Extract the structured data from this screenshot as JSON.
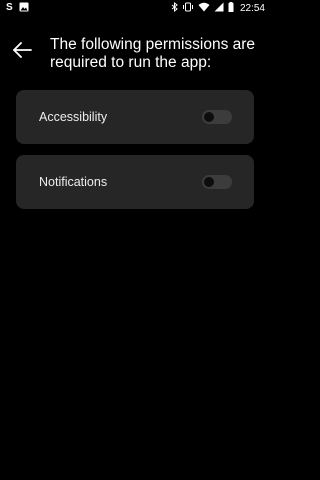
{
  "status_bar": {
    "time": "22:54",
    "left_icons": [
      "s-app-icon",
      "image-icon"
    ],
    "right_icons": [
      "bluetooth-icon",
      "vibrate-icon",
      "wifi-icon",
      "signal-icon",
      "battery-icon"
    ]
  },
  "header": {
    "title": "The following permissions are required to run the app:"
  },
  "permissions": [
    {
      "label": "Accessibility",
      "enabled": false
    },
    {
      "label": "Notifications",
      "enabled": false
    }
  ],
  "colors": {
    "background": "#000000",
    "card": "#262626",
    "text": "#ffffff",
    "toggle_track": "#3c3c3c",
    "toggle_knob": "#0d0d0d"
  }
}
